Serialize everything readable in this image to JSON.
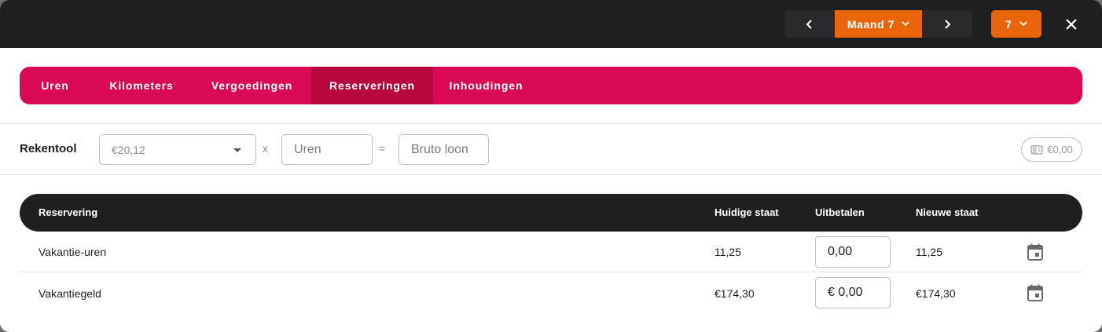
{
  "topbar": {
    "month_label": "Maand 7",
    "week_label": "7"
  },
  "tabs": [
    {
      "label": "Uren",
      "active": false
    },
    {
      "label": "Kilometers",
      "active": false
    },
    {
      "label": "Vergoedingen",
      "active": false
    },
    {
      "label": "Reserveringen",
      "active": true
    },
    {
      "label": "Inhoudingen",
      "active": false
    }
  ],
  "rekentool": {
    "label": "Rekentool",
    "rate_value": "€20,12",
    "multiply_op": "x",
    "hours_placeholder": "Uren",
    "equals_op": "=",
    "gross_placeholder": "Bruto loon",
    "total": "€0,00"
  },
  "table": {
    "headers": {
      "reservering": "Reservering",
      "huidige_staat": "Huidige staat",
      "uitbetalen": "Uitbetalen",
      "nieuwe_staat": "Nieuwe staat"
    },
    "rows": [
      {
        "name": "Vakantie-uren",
        "huidige_staat": "11,25",
        "uitbetalen": "0,00",
        "nieuwe_staat": "11,25"
      },
      {
        "name": "Vakantiegeld",
        "huidige_staat": "€174,30",
        "uitbetalen": "€ 0,00",
        "nieuwe_staat": "€174,30"
      }
    ]
  },
  "colors": {
    "accent_orange": "#e8650c",
    "tab_bar": "#d90a53",
    "tab_active": "#b8073f",
    "dark": "#1f1f21"
  },
  "icons": [
    "chevron-left-icon",
    "chevron-down-icon",
    "chevron-right-icon",
    "close-icon",
    "calculator-icon",
    "calendar-icon"
  ]
}
